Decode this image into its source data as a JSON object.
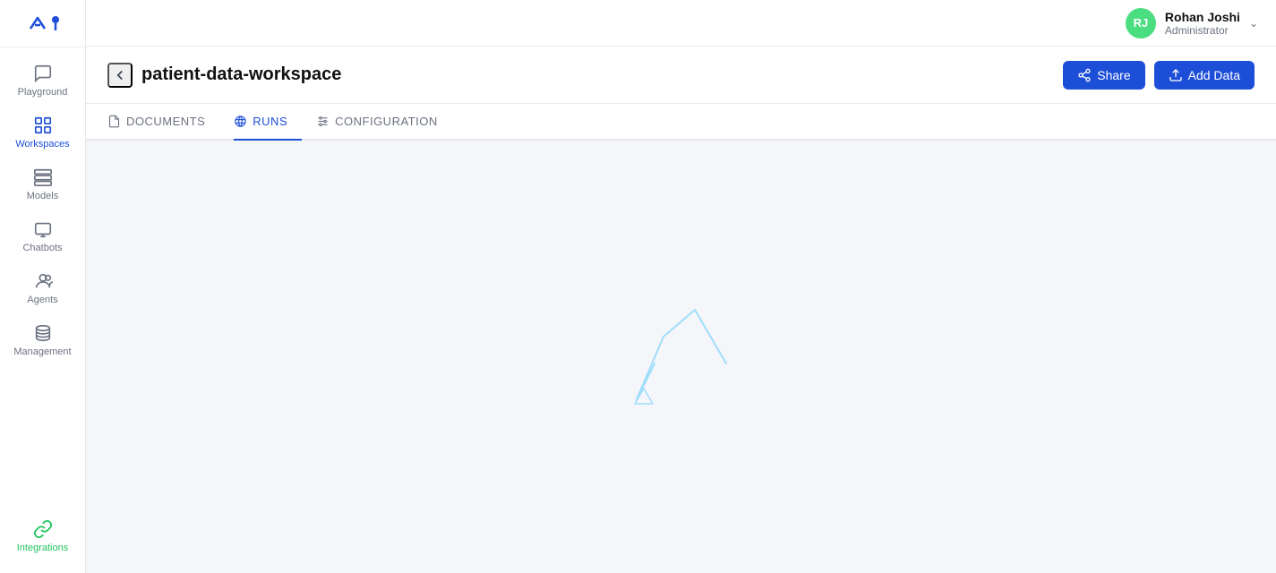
{
  "app": {
    "logo_alt": "ai logo"
  },
  "user": {
    "initials": "RJ",
    "name": "Rohan Joshi",
    "role": "Administrator",
    "avatar_color": "#4ade80"
  },
  "page": {
    "title": "patient-data-workspace",
    "back_label": "back"
  },
  "buttons": {
    "share": "Share",
    "add_data": "Add Data"
  },
  "tabs": [
    {
      "id": "documents",
      "label": "DOCUMENTS",
      "active": false
    },
    {
      "id": "runs",
      "label": "RUNS",
      "active": true
    },
    {
      "id": "configuration",
      "label": "CONFIGURATION",
      "active": false
    }
  ],
  "sidebar": {
    "items": [
      {
        "id": "playground",
        "label": "Playground",
        "icon": "chat-icon"
      },
      {
        "id": "workspaces",
        "label": "Workspaces",
        "icon": "workspaces-icon",
        "active": true
      },
      {
        "id": "models",
        "label": "Models",
        "icon": "models-icon"
      },
      {
        "id": "chatbots",
        "label": "Chatbots",
        "icon": "chatbots-icon"
      },
      {
        "id": "agents",
        "label": "Agents",
        "icon": "agents-icon"
      },
      {
        "id": "management",
        "label": "Management",
        "icon": "management-icon"
      }
    ],
    "bottom_items": [
      {
        "id": "integrations",
        "label": "Integrations",
        "icon": "link-icon"
      }
    ]
  }
}
